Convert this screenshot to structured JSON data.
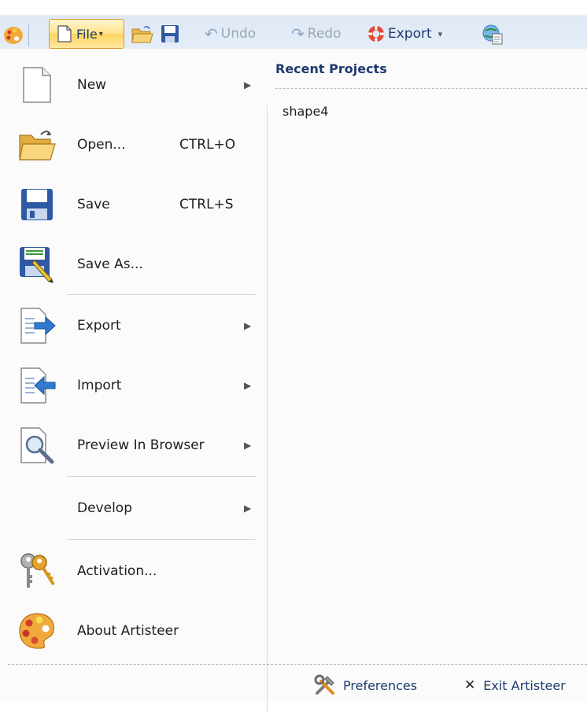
{
  "toolbar": {
    "file_label": "File",
    "undo_label": "Undo",
    "redo_label": "Redo",
    "export_label": "Export"
  },
  "menu": {
    "items": [
      {
        "label": "New",
        "shortcut": "",
        "submenu": true,
        "icon": "new-document-icon"
      },
      {
        "label": "Open...",
        "shortcut": "CTRL+O",
        "submenu": false,
        "icon": "open-folder-icon"
      },
      {
        "label": "Save",
        "shortcut": "CTRL+S",
        "submenu": false,
        "icon": "save-disk-icon"
      },
      {
        "label": "Save As...",
        "shortcut": "",
        "submenu": false,
        "icon": "save-as-icon"
      },
      {
        "label": "Export",
        "shortcut": "",
        "submenu": true,
        "icon": "export-icon"
      },
      {
        "label": "Import",
        "shortcut": "",
        "submenu": true,
        "icon": "import-icon"
      },
      {
        "label": "Preview In Browser",
        "shortcut": "",
        "submenu": true,
        "icon": "preview-magnifier-icon"
      },
      {
        "label": "Develop",
        "shortcut": "",
        "submenu": true,
        "icon": ""
      },
      {
        "label": "Activation...",
        "shortcut": "",
        "submenu": false,
        "icon": "keys-icon"
      },
      {
        "label": "About Artisteer",
        "shortcut": "",
        "submenu": false,
        "icon": "palette-icon"
      }
    ]
  },
  "recent": {
    "title": "Recent Projects",
    "items": [
      "shape4"
    ]
  },
  "footer": {
    "preferences_label": "Preferences",
    "exit_label": "Exit Artisteer"
  },
  "colors": {
    "accent": "#1e3a6e",
    "file_button": "#ffe28a",
    "toolbar_bg": "#e4edf8"
  }
}
